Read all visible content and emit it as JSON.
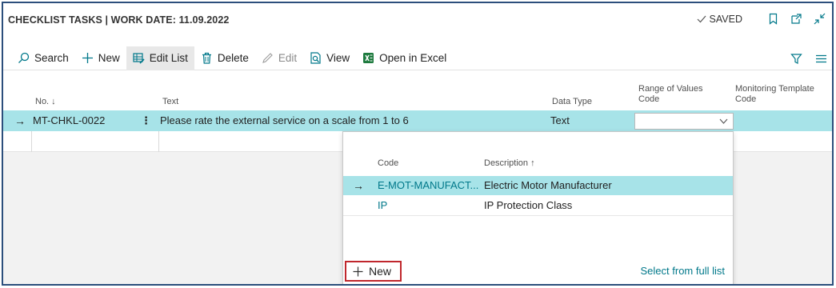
{
  "page": {
    "title": "CHECKLIST TASKS | WORK DATE: 11.09.2022",
    "status": "SAVED",
    "title_icons": [
      "bookmark-icon",
      "open-new-window-icon",
      "collapse-icon"
    ]
  },
  "actions": {
    "search": "Search",
    "new": "New",
    "edit_list": "Edit List",
    "delete": "Delete",
    "edit": "Edit",
    "view": "View",
    "open_excel": "Open in Excel"
  },
  "grid": {
    "columns": {
      "no": "No. ↓",
      "text": "Text",
      "data_type": "Data Type",
      "range_code_1": "Range of Values",
      "range_code_2": "Code",
      "template_code_1": "Monitoring Template",
      "template_code_2": "Code"
    },
    "rows": [
      {
        "no": "MT-CHKL-0022",
        "text": "Please rate the external service on a scale from 1 to 6",
        "data_type": "Text",
        "range_code": "",
        "template_code": ""
      }
    ]
  },
  "lookup": {
    "col_code": "Code",
    "col_description": "Description ↑",
    "rows": [
      {
        "code": "E-MOT-MANUFACT...",
        "description": "Electric Motor Manufacturer"
      },
      {
        "code": "IP",
        "description": "IP Protection Class"
      }
    ],
    "new_label": "New",
    "full_list_label": "Select from full list"
  },
  "colors": {
    "accent": "#00788a",
    "selected_row": "#a7e3e8",
    "frame": "#2c4f7c",
    "highlight_border": "#c0272d"
  }
}
